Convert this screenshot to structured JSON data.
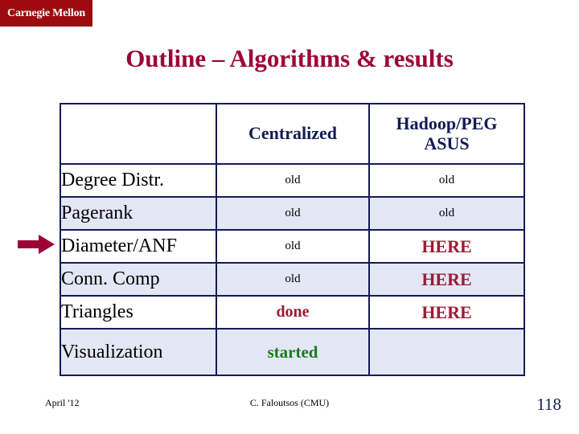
{
  "logo": {
    "text": "Carnegie Mellon",
    "background_color": "#9d0b0e",
    "text_color": "#ffffff"
  },
  "title": {
    "text": "Outline – Algorithms & results",
    "color": "#9e0234"
  },
  "marker": {
    "icon": "right-arrow-icon",
    "color": "#9e0234",
    "points_to_row": "Diameter/ANF"
  },
  "table": {
    "columns": [
      {
        "key": "metric",
        "label": ""
      },
      {
        "key": "centralized",
        "label": "Centralized"
      },
      {
        "key": "hadoop",
        "label_line1": "Hadoop/PEG",
        "label_line2": "ASUS"
      }
    ],
    "header_color": "#141b55",
    "border_color": "#141b55",
    "shade_color": "#e3e7f5",
    "rows": [
      {
        "metric": "Degree Distr.",
        "centralized": "old",
        "centralized_style": "old",
        "hadoop": "old",
        "hadoop_style": "old",
        "shaded": false
      },
      {
        "metric": "Pagerank",
        "centralized": "old",
        "centralized_style": "old",
        "hadoop": "old",
        "hadoop_style": "old",
        "shaded": true
      },
      {
        "metric": "Diameter/ANF",
        "centralized": "old",
        "centralized_style": "old",
        "hadoop": "HERE",
        "hadoop_style": "here",
        "shaded": false
      },
      {
        "metric": "Conn. Comp",
        "centralized": "old",
        "centralized_style": "old",
        "hadoop": "HERE",
        "hadoop_style": "here",
        "shaded": true
      },
      {
        "metric": "Triangles",
        "centralized": "done",
        "centralized_style": "done",
        "hadoop": "HERE",
        "hadoop_style": "here",
        "shaded": false
      },
      {
        "metric": "Visualization",
        "centralized": "started",
        "centralized_style": "started",
        "hadoop": "",
        "hadoop_style": "empty",
        "shaded": true
      }
    ],
    "status_colors": {
      "old": "#000000",
      "done": "#9e1b33",
      "here": "#9e1b33",
      "started": "#1a7a1a"
    }
  },
  "footer": {
    "date": "April '12",
    "author": "C. Faloutsos (CMU)",
    "page_number": "118"
  }
}
